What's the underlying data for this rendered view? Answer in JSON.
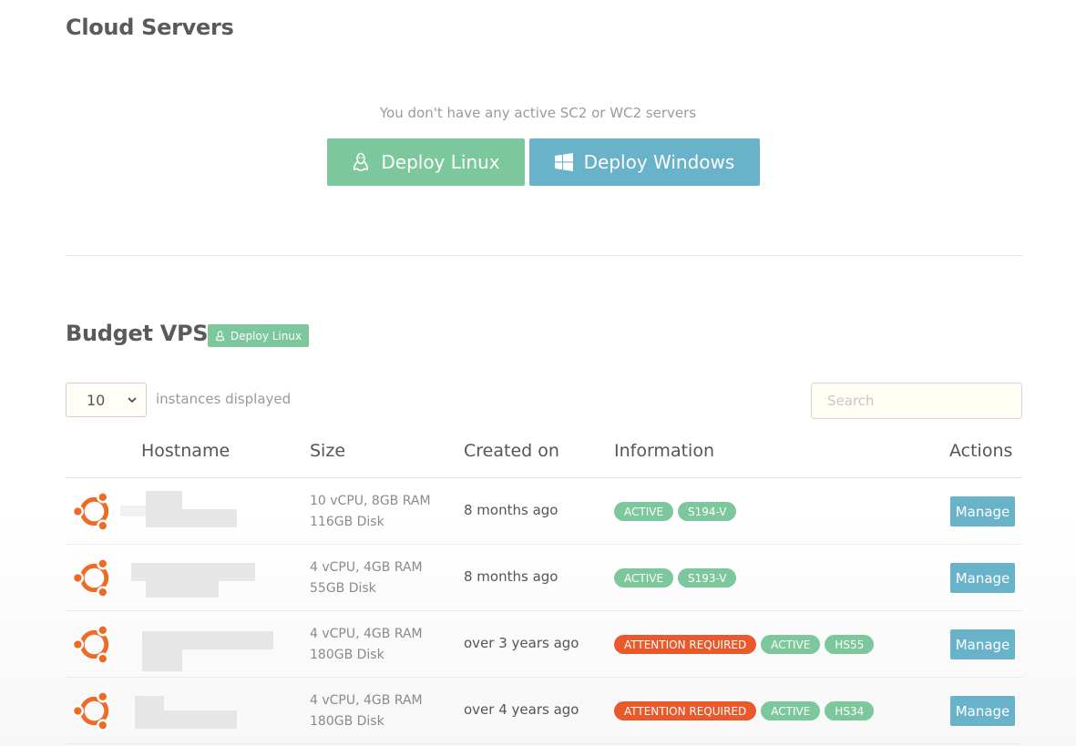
{
  "cloud": {
    "title": "Cloud Servers",
    "empty_message": "You don't have any active SC2 or WC2 servers",
    "deploy_linux": "Deploy Linux",
    "deploy_windows": "Deploy Windows"
  },
  "budget": {
    "title": "Budget VPS",
    "deploy_linux": "Deploy Linux",
    "length_value": "10",
    "length_label": "instances displayed",
    "search_placeholder": "Search"
  },
  "columns": {
    "hostname": "Hostname",
    "size": "Size",
    "created": "Created on",
    "information": "Information",
    "actions": "Actions"
  },
  "rows": [
    {
      "os": "ubuntu-icon",
      "size_cpu": "10 vCPU, 8GB RAM",
      "size_disk": "116GB Disk",
      "created": "8 months ago",
      "badges": [
        {
          "text": "ACTIVE",
          "color": "#7cc79b"
        },
        {
          "text": "S194-V",
          "color": "#7cc79b"
        }
      ],
      "action": "Manage"
    },
    {
      "os": "ubuntu-icon",
      "size_cpu": "4 vCPU, 4GB RAM",
      "size_disk": "55GB Disk",
      "created": "8 months ago",
      "badges": [
        {
          "text": "ACTIVE",
          "color": "#7cc79b"
        },
        {
          "text": "S193-V",
          "color": "#7cc79b"
        }
      ],
      "action": "Manage"
    },
    {
      "os": "ubuntu-icon",
      "size_cpu": "4 vCPU, 4GB RAM",
      "size_disk": "180GB Disk",
      "created": "over 3 years ago",
      "badges": [
        {
          "text": "ATTENTION REQUIRED",
          "color": "#e8592c"
        },
        {
          "text": "ACTIVE",
          "color": "#7cc79b"
        },
        {
          "text": "HS55",
          "color": "#7cc79b"
        }
      ],
      "action": "Manage"
    },
    {
      "os": "ubuntu-icon",
      "size_cpu": "4 vCPU, 4GB RAM",
      "size_disk": "180GB Disk",
      "created": "over 4 years ago",
      "badges": [
        {
          "text": "ATTENTION REQUIRED",
          "color": "#e8592c"
        },
        {
          "text": "ACTIVE",
          "color": "#7cc79b"
        },
        {
          "text": "HS34",
          "color": "#7cc79b"
        }
      ],
      "action": "Manage"
    }
  ],
  "colors": {
    "green": "#7cc79b",
    "blue": "#68b3c9",
    "red": "#e8592c",
    "ubuntu": "#ef6a22"
  }
}
